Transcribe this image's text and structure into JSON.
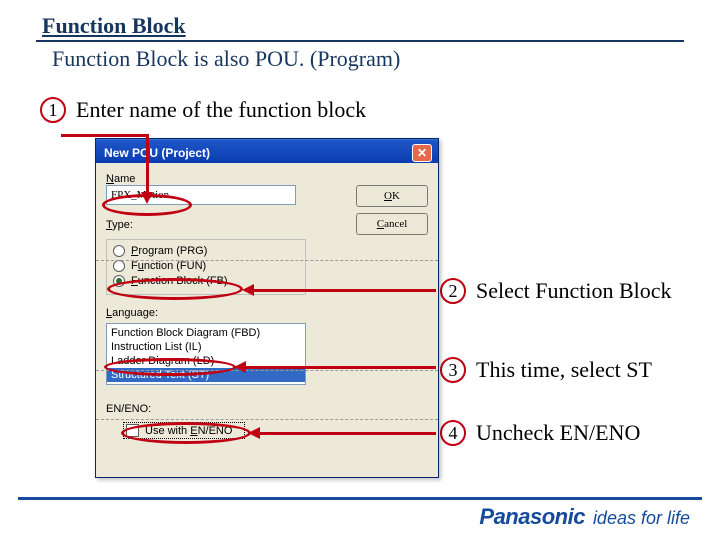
{
  "header": {
    "title": "Function Block",
    "subtitle": "Function Block is also POU. (Program)"
  },
  "steps": {
    "s1": {
      "num": "1",
      "text": "Enter name of the function block"
    },
    "s2": {
      "num": "2",
      "text": "Select Function Block"
    },
    "s3": {
      "num": "3",
      "text": "This time, select ST"
    },
    "s4": {
      "num": "4",
      "text": "Uncheck EN/ENO"
    }
  },
  "dialog": {
    "title": "New POU (Project)",
    "name_label": "Name",
    "name_value": "FPX_Motion",
    "ok_label": "OK",
    "cancel_label": "Cancel",
    "type_label": "Type:",
    "type_options": [
      {
        "label": "Program (PRG)",
        "checked": false
      },
      {
        "label": "Function (FUN)",
        "checked": false
      },
      {
        "label": "Function Block (FB)",
        "checked": true
      }
    ],
    "language_label": "Language:",
    "language_options": [
      {
        "label": "Function Block Diagram (FBD)",
        "selected": false
      },
      {
        "label": "Instruction List (IL)",
        "selected": false
      },
      {
        "label": "Ladder Diagram (LD)",
        "selected": false
      },
      {
        "label": "Structured Text (ST)",
        "selected": true
      }
    ],
    "eneno_label": "EN/ENO:",
    "eneno_check_label": "Use with EN/ENO",
    "eneno_checked": false
  },
  "footer": {
    "brand": "Panasonic",
    "tagline": "ideas for life"
  }
}
